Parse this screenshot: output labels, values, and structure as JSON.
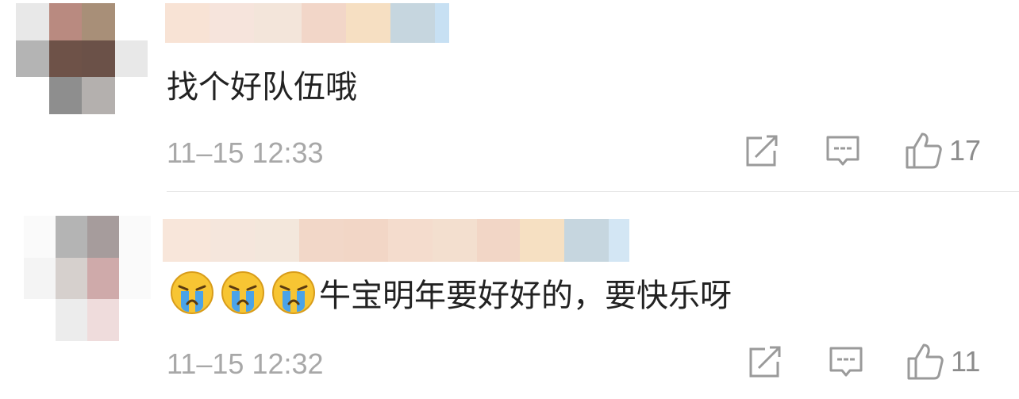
{
  "comments": [
    {
      "text": "找个好队伍哦",
      "timestamp": "11–15 12:33",
      "like_count": "17",
      "emojis": [],
      "icons": {
        "share": "share-icon",
        "reply": "comment-icon",
        "like": "thumbs-up-icon"
      }
    },
    {
      "text": "牛宝明年要好好的，要快乐呀",
      "timestamp": "11–15 12:32",
      "like_count": "11",
      "emojis": [
        "crying-face-emoji",
        "crying-face-emoji",
        "crying-face-emoji"
      ],
      "icons": {
        "share": "share-icon",
        "reply": "comment-icon",
        "like": "thumbs-up-icon"
      }
    }
  ],
  "colors": {
    "text": "#222222",
    "meta": "#a8a8a8",
    "icon": "#9a9a9a",
    "divider": "#e6e6e6"
  }
}
